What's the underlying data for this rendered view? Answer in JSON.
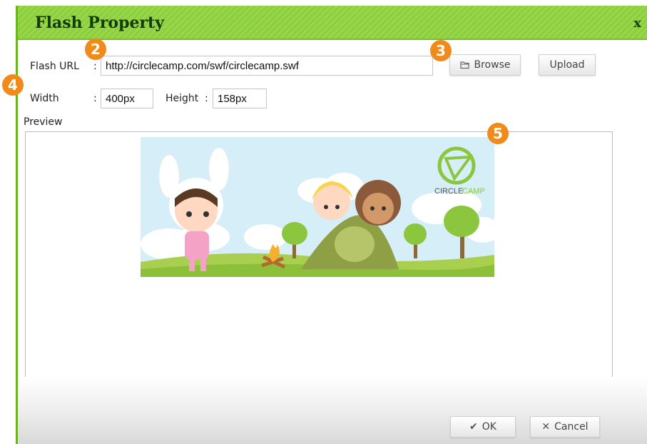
{
  "dialog": {
    "title": "Flash Property",
    "close_label": "x"
  },
  "form": {
    "url_label": "Flash URL",
    "colon": ":",
    "url_value": "http://circlecamp.com/swf/circlecamp.swf",
    "browse_label": "Browse",
    "upload_label": "Upload",
    "width_label": "Width",
    "width_value": "400px",
    "height_label": "Height",
    "height_value": "158px",
    "preview_label": "Preview"
  },
  "preview": {
    "logo_text_1": "CIRCLE",
    "logo_text_2": "CAMP"
  },
  "footer": {
    "ok_label": "OK",
    "cancel_label": "Cancel"
  },
  "callouts": [
    "2",
    "3",
    "4",
    "5"
  ],
  "colors": {
    "accent_green": "#8cce3d",
    "title_text": "#143c0a",
    "callout_orange": "#f08a1a"
  }
}
